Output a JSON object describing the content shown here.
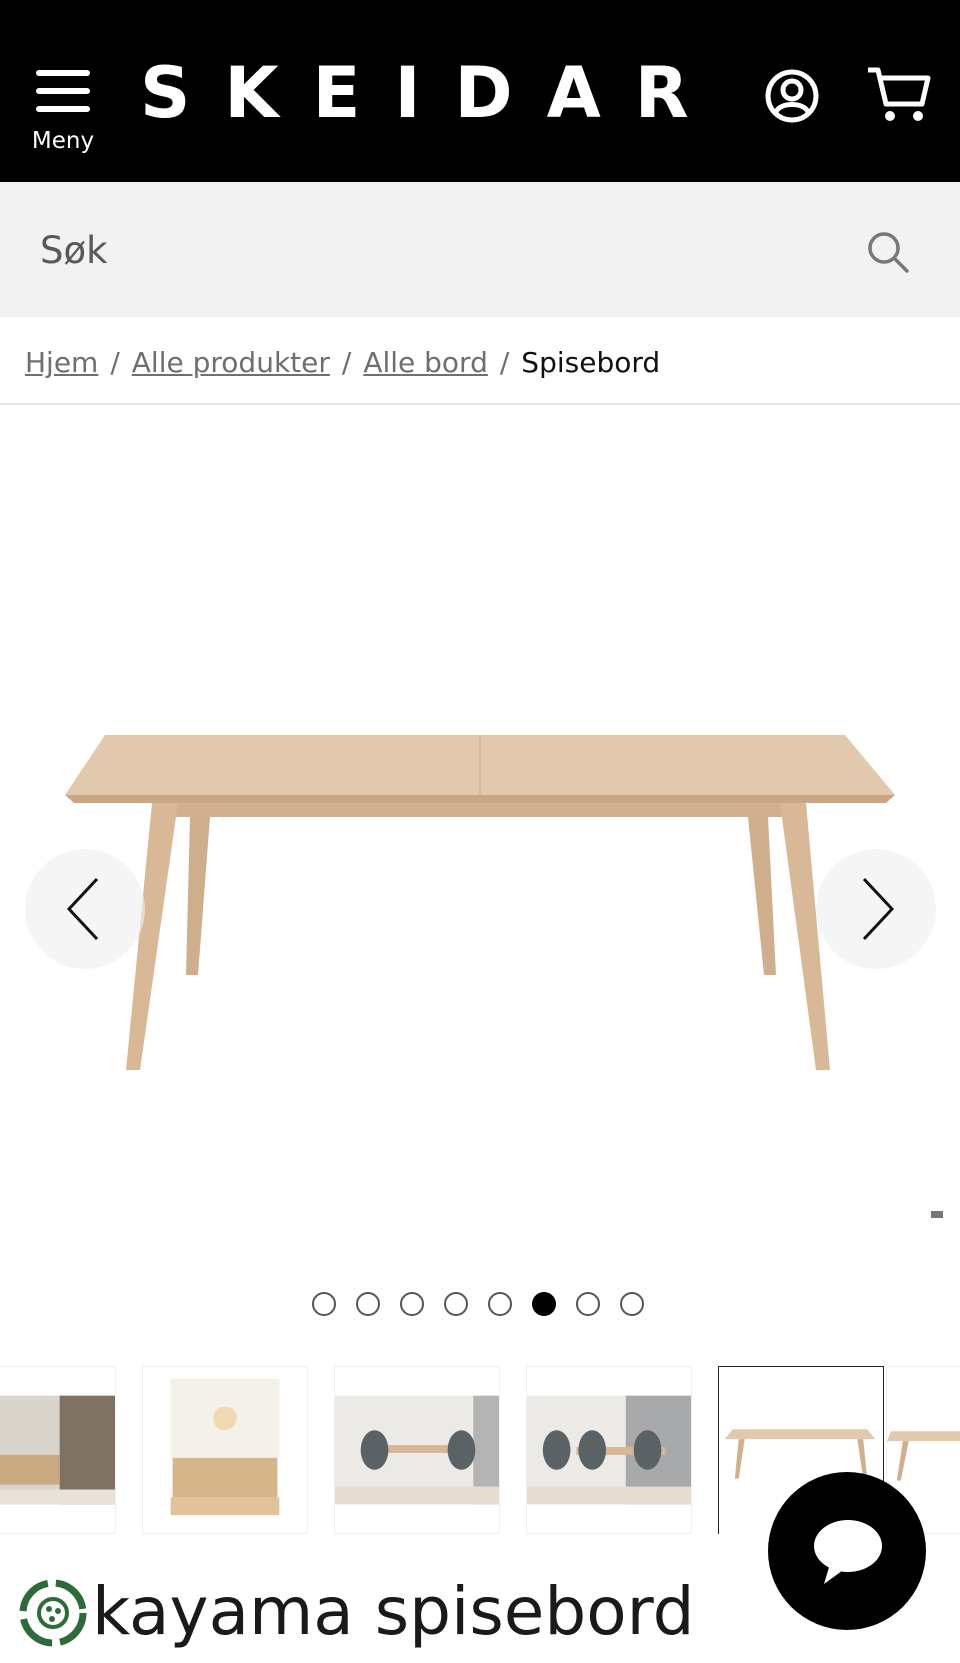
{
  "header": {
    "menu_label": "Meny",
    "logo_text": "SKEIDAR",
    "icons": [
      "menu-icon",
      "account-icon",
      "cart-icon"
    ],
    "background": "#000000"
  },
  "search": {
    "placeholder": "Søk",
    "icon": "search-icon"
  },
  "breadcrumb": {
    "items": [
      {
        "label": "Hjem"
      },
      {
        "label": "Alle produkter"
      },
      {
        "label": "Alle bord"
      }
    ],
    "separator": "/",
    "current": "Spisebord"
  },
  "gallery": {
    "prev_icon": "chevron-left-icon",
    "next_icon": "chevron-right-icon",
    "image_count": 8,
    "active_index": 6
  },
  "thumbnails": {
    "count": 6,
    "active_index": 5
  },
  "product": {
    "title_visible": "kayama spisebord"
  },
  "chat": {
    "icon": "chat-bubble-icon"
  },
  "colors": {
    "header_bg": "#000000",
    "search_bg": "#f2f2f2",
    "wood": "#d9b99a"
  }
}
